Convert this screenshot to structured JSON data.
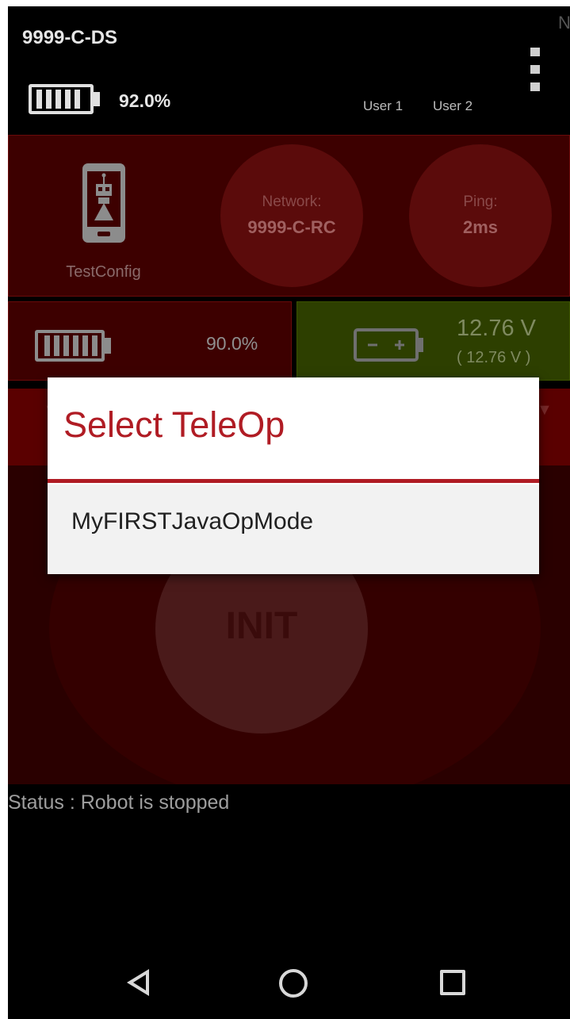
{
  "header": {
    "ds_name": "9999-C-DS",
    "corner_letter": "N",
    "ds_battery": "92.0%",
    "user1": "User 1",
    "user2": "User 2"
  },
  "robot_config": {
    "label": "TestConfig"
  },
  "network": {
    "label": "Network:",
    "value": "9999-C-RC"
  },
  "ping": {
    "label": "Ping:",
    "value": "2ms"
  },
  "robot_phone_battery": "90.0%",
  "robot_voltage": {
    "value": "12.76 V",
    "sub": "( 12.76 V )"
  },
  "init_button": "INIT",
  "status": "Status : Robot is stopped",
  "dialog": {
    "title": "Select TeleOp",
    "items": [
      "MyFIRSTJavaOpMode"
    ]
  },
  "colors": {
    "accent": "#b01c24",
    "panel": "#3d0000",
    "voltage_panel": "#2d3f00"
  }
}
